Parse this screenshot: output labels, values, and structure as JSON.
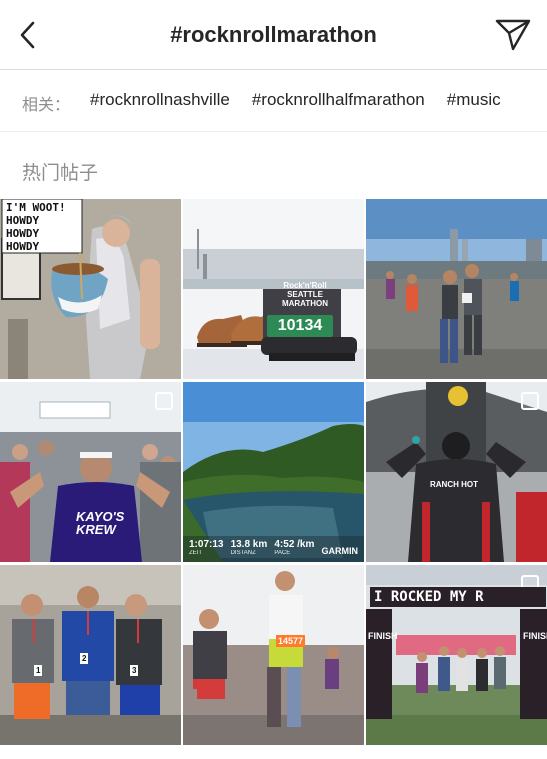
{
  "header": {
    "title": "#rocknrollmarathon",
    "back_icon": "chevron-left-icon",
    "share_icon": "paper-plane-icon"
  },
  "related": {
    "label": "相关：",
    "tags": [
      "#rocknrollnashville",
      "#rocknrollhalfmarathon",
      "#music"
    ]
  },
  "section": {
    "title": "热门帖子"
  },
  "posts": [
    {
      "sign_lines": [
        "I'M WOOT!",
        "HOWDY",
        "HOWDY",
        "HOWDY"
      ]
    },
    {
      "logo": "Rock'n'Roll SEATTLE MARATHON",
      "bib": "10134"
    },
    {},
    {
      "shirt": "KAYO'S KREW"
    },
    {
      "stats": [
        {
          "value": "1:07:13",
          "label": "ZEIT"
        },
        {
          "value": "13.8 km",
          "label": "DISTANZ"
        },
        {
          "value": "4:52 /km",
          "label": "PACE"
        }
      ],
      "brand": "GARMIN"
    },
    {
      "jacket": "RANCH HOT"
    },
    {
      "bibs": [
        "1",
        "2",
        "3"
      ]
    },
    {
      "bib": "14577"
    },
    {
      "banner": "I ROCKED MY R",
      "finish": "FINISH"
    }
  ],
  "colors": {
    "text": "#262626",
    "muted": "#8e8e8e",
    "divider": "#dbdbdb"
  }
}
